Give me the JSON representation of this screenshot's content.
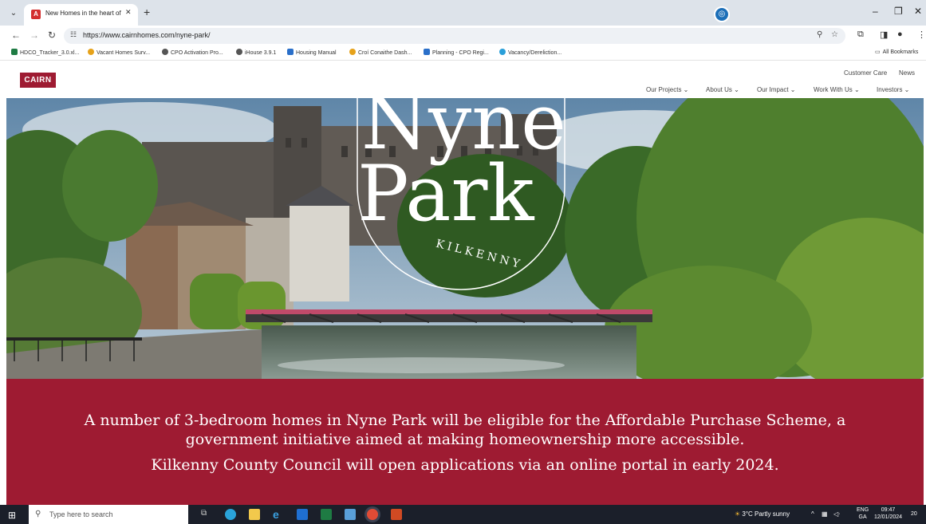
{
  "browser": {
    "tab_title": "New Homes in the heart of Kilk",
    "url": "https://www.cairnhomes.com/nyne-park/",
    "bookmarks": [
      {
        "label": "HDCO_Tracker_3.0.xl...",
        "color": "#1e7b43"
      },
      {
        "label": "Vacant Homes Surv...",
        "color": "#e6a21a"
      },
      {
        "label": "CPO Activation Pro...",
        "color": "#555555"
      },
      {
        "label": "iHouse 3.9.1",
        "color": "#555555"
      },
      {
        "label": "Housing Manual",
        "color": "#2a6fc9"
      },
      {
        "label": "Croí Conaithe Dash...",
        "color": "#e6a21a"
      },
      {
        "label": "Planning - CPO Regi...",
        "color": "#2a6fc9"
      },
      {
        "label": "Vacancy/Dereliction...",
        "color": "#2a9fd9"
      }
    ],
    "all_bookmarks": "All Bookmarks"
  },
  "site": {
    "logo": "CAIRN",
    "util_links": [
      "Customer Care",
      "News"
    ],
    "nav": [
      "Our Projects ⌄",
      "About Us ⌄",
      "Our Impact ⌄",
      "Work With Us ⌄",
      "Investors ⌄"
    ],
    "brand_color": "#9e1b32"
  },
  "hero": {
    "title_line1": "Nyne",
    "title_line2": "Park",
    "subtitle": "KILKENNY"
  },
  "banner": {
    "line1": "A number of 3-bedroom homes in Nyne Park will be eligible for the Affordable Purchase Scheme, a",
    "line2": "government initiative aimed at making homeownership more accessible.",
    "line3": "Kilkenny County Council will open applications via an online portal in early 2024."
  },
  "taskbar": {
    "search_placeholder": "Type here to search",
    "weather": "3°C  Partly sunny",
    "lang_top": "ENG",
    "lang_bottom": "GA",
    "time": "09:47",
    "date": "12/01/2024",
    "notifications": "20"
  }
}
